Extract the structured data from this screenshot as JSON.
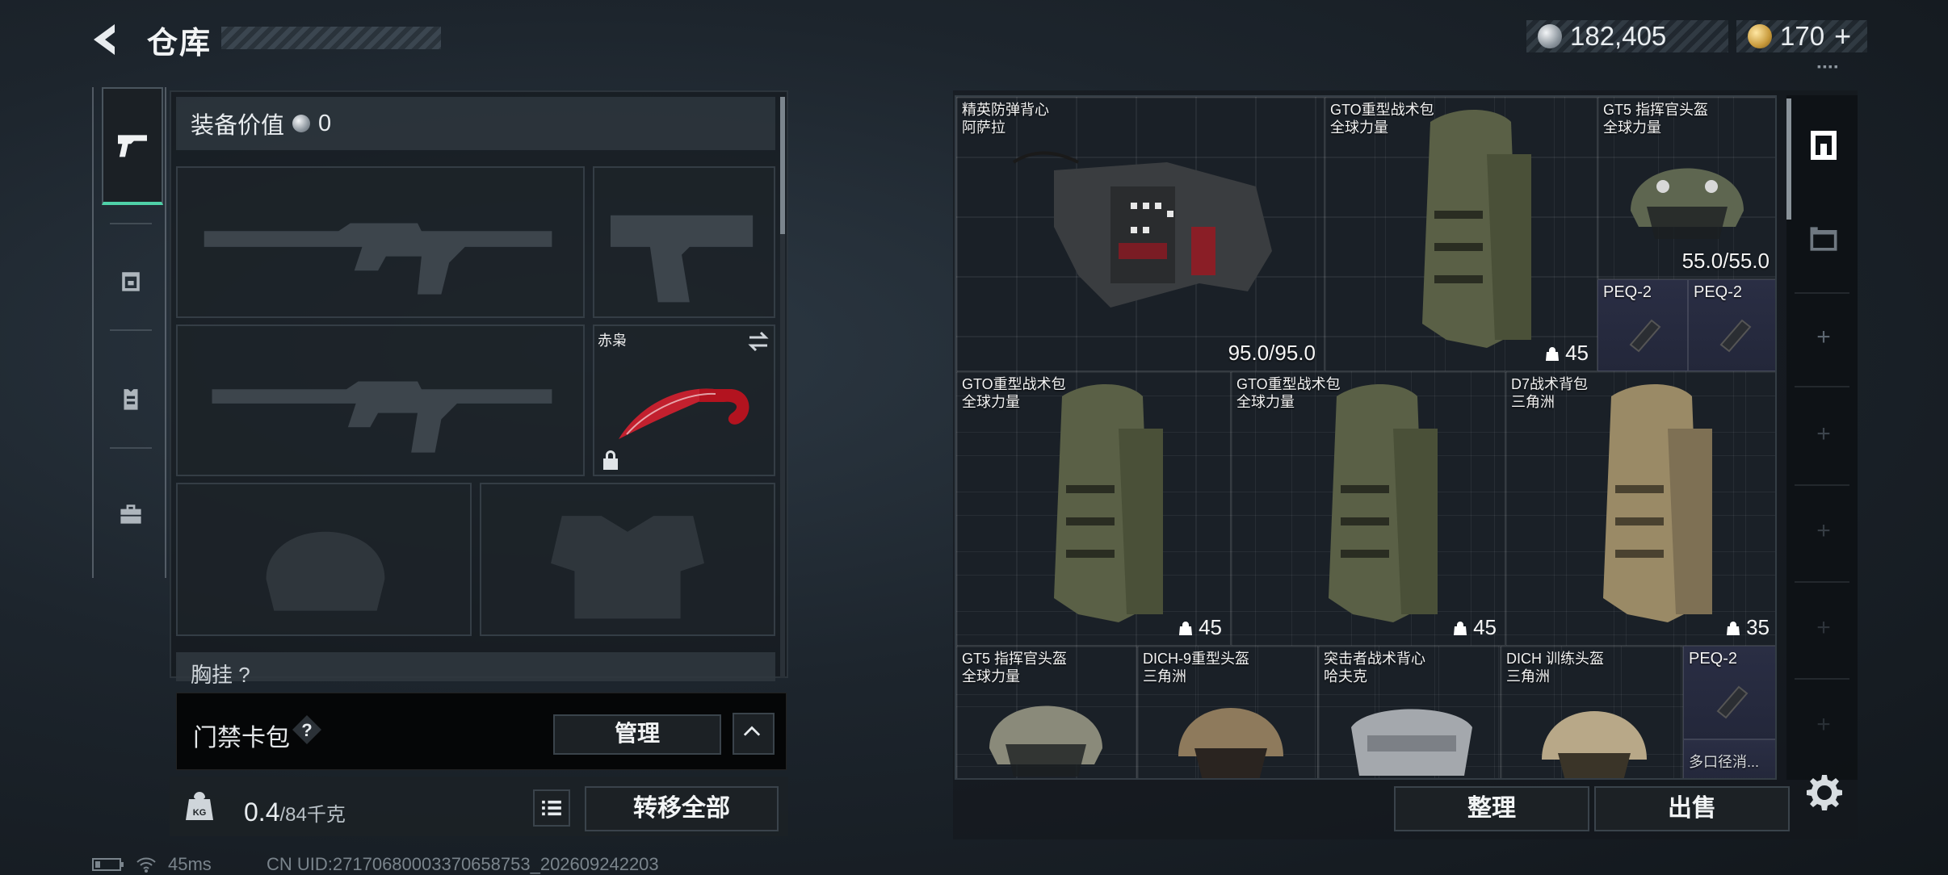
{
  "header": {
    "title": "仓库",
    "currency_primary": "182,405",
    "currency_secondary": "170",
    "currency_plus": "+",
    "version_mark": "▪▪▪▪"
  },
  "nav": {
    "items": [
      "weapons",
      "helmet",
      "vest",
      "toolbox"
    ],
    "active": "weapons"
  },
  "loadout": {
    "value_label": "装备价值",
    "value": "0",
    "melee_name": "赤枭",
    "chest_label": "胸挂 ?",
    "card_label": "门禁卡包",
    "manage_label": "管理",
    "weight_value": "0.4",
    "weight_unit": "/84千克",
    "transfer_label": "转移全部"
  },
  "stash": {
    "items": [
      {
        "name": "精英防弹背心",
        "maker": "阿萨拉",
        "durability": "95.0/95.0",
        "rarity": "brown"
      },
      {
        "name": "GTO重型战术包",
        "maker": "全球力量",
        "capacity": "45",
        "rarity": "red"
      },
      {
        "name": "GT5 指挥官头盔",
        "maker": "全球力量",
        "durability": "55.0/55.0",
        "rarity": "red"
      },
      {
        "name": "PEQ-2",
        "rarity": "blue"
      },
      {
        "name": "PEQ-2",
        "rarity": "blue"
      },
      {
        "name": "GTO重型战术包",
        "maker": "全球力量",
        "capacity": "45",
        "rarity": "red"
      },
      {
        "name": "GTO重型战术包",
        "maker": "全球力量",
        "capacity": "45",
        "rarity": "red"
      },
      {
        "name": "D7战术背包",
        "maker": "三角洲",
        "capacity": "35",
        "rarity": "red"
      },
      {
        "name": "GT5 指挥官头盔",
        "maker": "全球力量",
        "rarity": "red"
      },
      {
        "name": "DICH-9重型头盔",
        "maker": "三角洲",
        "rarity": "red"
      },
      {
        "name": "突击者战术背心",
        "maker": "哈夫克",
        "rarity": "blue"
      },
      {
        "name": "DICH 训练头盔",
        "maker": "三角洲",
        "rarity": "blue"
      },
      {
        "name": "PEQ-2",
        "rarity": "blue"
      },
      {
        "name": "多口径消...",
        "rarity": "blue"
      }
    ],
    "sort_label": "整理",
    "sell_label": "出售"
  },
  "status": {
    "ping": "45ms",
    "uid": "CN UID:27170680003370658753_202609242203"
  },
  "colors": {
    "accent": "#4fd1a8",
    "rare_red": "#6a2530",
    "rare_brown": "#4a3526",
    "rare_blue": "#2a2e44"
  },
  "icons": [
    "back-arrow-icon",
    "silver-coin-icon",
    "gold-coin-icon",
    "pistol-icon",
    "helmet-icon",
    "vest-icon",
    "toolbox-icon",
    "help-icon",
    "chevron-up-icon",
    "kg-weight-icon",
    "list-icon",
    "backpack-icon",
    "container-icon",
    "plus-icon",
    "settings-icon",
    "battery-icon",
    "wifi-icon",
    "swap-icon",
    "lock-icon"
  ]
}
